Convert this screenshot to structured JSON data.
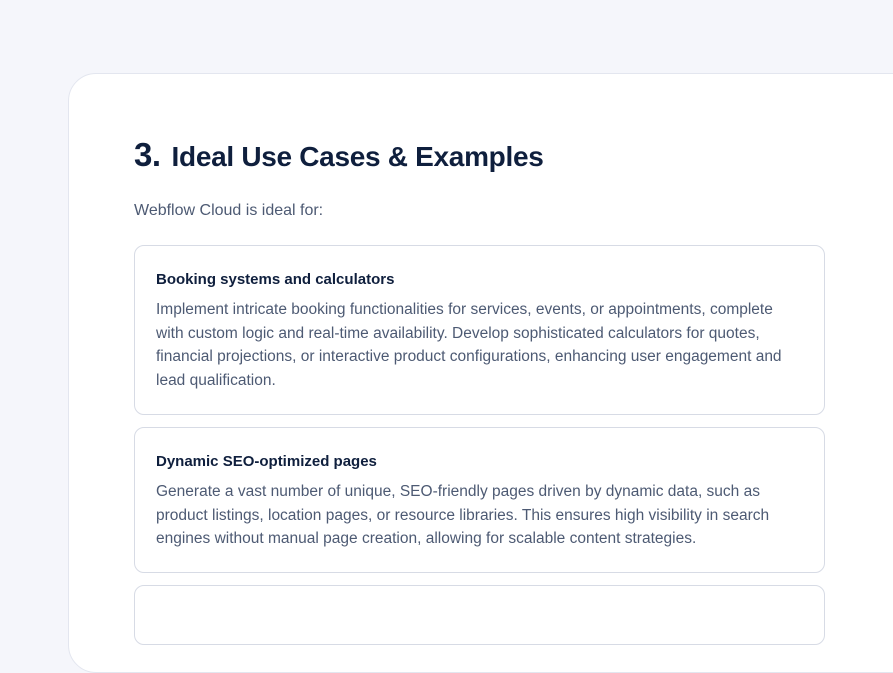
{
  "section": {
    "number": "3.",
    "title": "Ideal Use Cases & Examples",
    "intro": "Webflow Cloud is ideal for:"
  },
  "cards": [
    {
      "title": "Booking systems and calculators",
      "body": "Implement intricate booking functionalities for services, events, or appointments, complete with custom logic and real-time availability. Develop sophisticated calculators for quotes, financial projections, or interactive product configurations, enhancing user engagement and lead qualification."
    },
    {
      "title": "Dynamic SEO-optimized pages",
      "body": "Generate a vast number of unique, SEO-friendly pages driven by dynamic data, such as product listings, location pages, or resource libraries. This ensures high visibility in search engines without manual page creation, allowing for scalable content strategies."
    }
  ],
  "colors": {
    "heading": "#0f1f3d",
    "body_text": "#4d5a73",
    "card_border": "#d7dbe5",
    "page_background": "#f5f6fb"
  }
}
